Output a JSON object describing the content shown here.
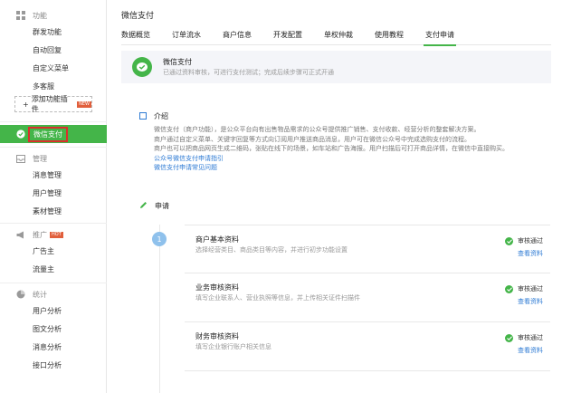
{
  "sidebar": {
    "features": {
      "title": "功能",
      "items": [
        "群发功能",
        "自动回复",
        "自定义菜单",
        "多客服"
      ]
    },
    "add_plugin": {
      "label": "添加功能插件",
      "badge": "NEW"
    },
    "active": {
      "label": "微信支付"
    },
    "management": {
      "title": "管理",
      "items": [
        "消息管理",
        "用户管理",
        "素材管理"
      ]
    },
    "promotion": {
      "title": "推广",
      "badge": "HOT",
      "items": [
        "广告主",
        "流量主"
      ]
    },
    "stats": {
      "title": "统计",
      "items": [
        "用户分析",
        "图文分析",
        "消息分析",
        "接口分析"
      ]
    }
  },
  "page": {
    "title": "微信支付"
  },
  "tabs": [
    "数据概览",
    "订单流水",
    "商户信息",
    "开发配置",
    "单权仲裁",
    "使用教程",
    "支付申请"
  ],
  "banner": {
    "title": "微信支付",
    "subtitle": "已通过资料审核，可进行支付测试；完成后续步骤可正式开通"
  },
  "intro": {
    "title": "介绍",
    "lines": [
      "微信支付（商户功能），是公众平台向有出售物品需求的公众号提供推广销售、支付收款、经营分析的整套解决方案。",
      "商户通过自定义菜单、关键字回复等方式向订阅用户推送商品消息，用户可在微信公众号中完成选购支付的流程。",
      "商户也可以把商品网页生成二维码，张贴在线下的场景，如车站和广告海报。用户扫描后可打开商品详情，在微信中直接购买。"
    ],
    "links": [
      "公众号微信支付申请指引",
      "微信支付申请常见问题"
    ]
  },
  "apply": {
    "title": "申请"
  },
  "steps": {
    "number": "1",
    "cards": [
      {
        "title": "商户基本资料",
        "desc": "选择经营类目、商品类目等内容，并进行初步功能设置",
        "status": "审核通过",
        "link": "查看资料"
      },
      {
        "title": "业务审核资料",
        "desc": "填写企业联系人、营业执照等信息，并上传相关证件扫描件",
        "status": "审核通过",
        "link": "查看资料"
      },
      {
        "title": "财务审核资料",
        "desc": "填写企业银行账户相关信息",
        "status": "审核通过",
        "link": "查看资料"
      }
    ]
  },
  "colors": {
    "accent": "#44b549",
    "link": "#2e7bd4",
    "active_outline": "#d9302c"
  }
}
